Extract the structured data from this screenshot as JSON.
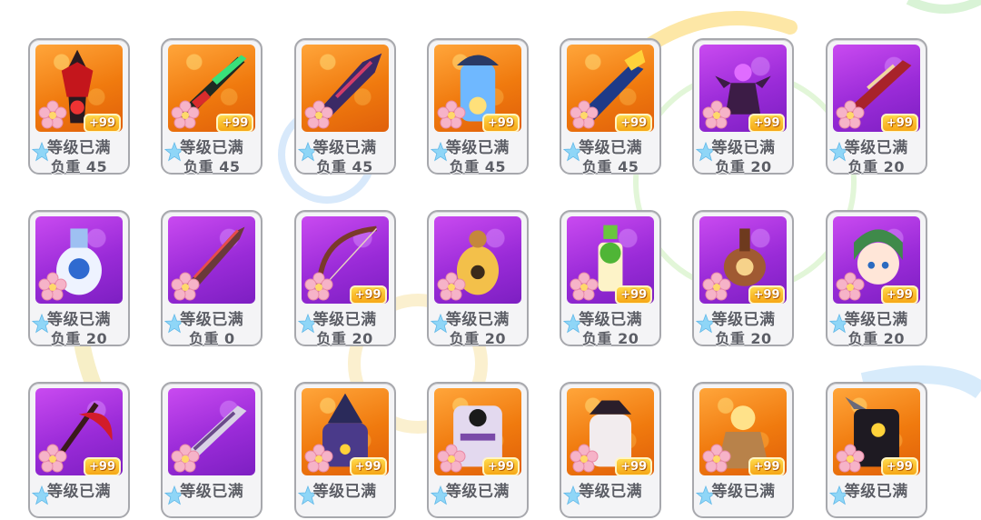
{
  "colors": {
    "card_border": "#a7a8ad",
    "card_bg": "#f4f4f6",
    "frame_orange": "#f07a0e",
    "frame_purple": "#9a2bd8",
    "badge": "#f6b520",
    "label_text": "#5c5e66"
  },
  "rows": [
    [
      {
        "art": "spiked-red-armor-icon",
        "frame": "orange",
        "badge": "+99",
        "status": "等级已满",
        "weight": "负重 45"
      },
      {
        "art": "green-energy-rifle-icon",
        "frame": "orange",
        "badge": "+99",
        "status": "等级已满",
        "weight": "负重 45"
      },
      {
        "art": "dark-blade-icon",
        "frame": "orange",
        "badge": "",
        "status": "等级已满",
        "weight": "负重 45"
      },
      {
        "art": "crystal-urn-icon",
        "frame": "orange",
        "badge": "+99",
        "status": "等级已满",
        "weight": "负重 45"
      },
      {
        "art": "heavy-cannon-icon",
        "frame": "orange",
        "badge": "+99",
        "status": "等级已满",
        "weight": "负重 45"
      },
      {
        "art": "purple-orb-pedestal-icon",
        "frame": "purple",
        "badge": "+99",
        "status": "等级已满",
        "weight": "负重 20"
      },
      {
        "art": "red-dragon-rifle-icon",
        "frame": "purple",
        "badge": "+99",
        "status": "等级已满",
        "weight": "负重 20"
      }
    ],
    [
      {
        "art": "porcelain-vase-icon",
        "frame": "purple",
        "badge": "",
        "status": "等级已满",
        "weight": "负重 20"
      },
      {
        "art": "serrated-sword-icon",
        "frame": "purple",
        "badge": "",
        "status": "等级已满",
        "weight": "负重 0"
      },
      {
        "art": "ornate-bow-icon",
        "frame": "purple",
        "badge": "+99",
        "status": "等级已满",
        "weight": "负重 20"
      },
      {
        "art": "teddy-egg-icon",
        "frame": "purple",
        "badge": "",
        "status": "等级已满",
        "weight": "负重 20"
      },
      {
        "art": "plant-bottle-icon",
        "frame": "purple",
        "badge": "+99",
        "status": "等级已满",
        "weight": "负重 20"
      },
      {
        "art": "clockwork-pot-icon",
        "frame": "purple",
        "badge": "+99",
        "status": "等级已满",
        "weight": "负重 20"
      },
      {
        "art": "green-hood-girl-icon",
        "frame": "purple",
        "badge": "+99",
        "status": "等级已满",
        "weight": "负重 20"
      }
    ],
    [
      {
        "art": "red-scythe-icon",
        "frame": "purple",
        "badge": "+99",
        "status": "等级已满",
        "weight": ""
      },
      {
        "art": "gothic-gun-icon",
        "frame": "purple",
        "badge": "",
        "status": "等级已满",
        "weight": ""
      },
      {
        "art": "witch-hat-costume-icon",
        "frame": "orange",
        "badge": "+99",
        "status": "等级已满",
        "weight": ""
      },
      {
        "art": "pirate-skull-costume-icon",
        "frame": "orange",
        "badge": "+99",
        "status": "等级已满",
        "weight": ""
      },
      {
        "art": "maid-dress-costume-icon",
        "frame": "orange",
        "badge": "+99",
        "status": "等级已满",
        "weight": ""
      },
      {
        "art": "blonde-doll-costume-icon",
        "frame": "orange",
        "badge": "+99",
        "status": "等级已满",
        "weight": ""
      },
      {
        "art": "dark-armor-costume-icon",
        "frame": "orange",
        "badge": "+99",
        "status": "等级已满",
        "weight": ""
      }
    ]
  ]
}
